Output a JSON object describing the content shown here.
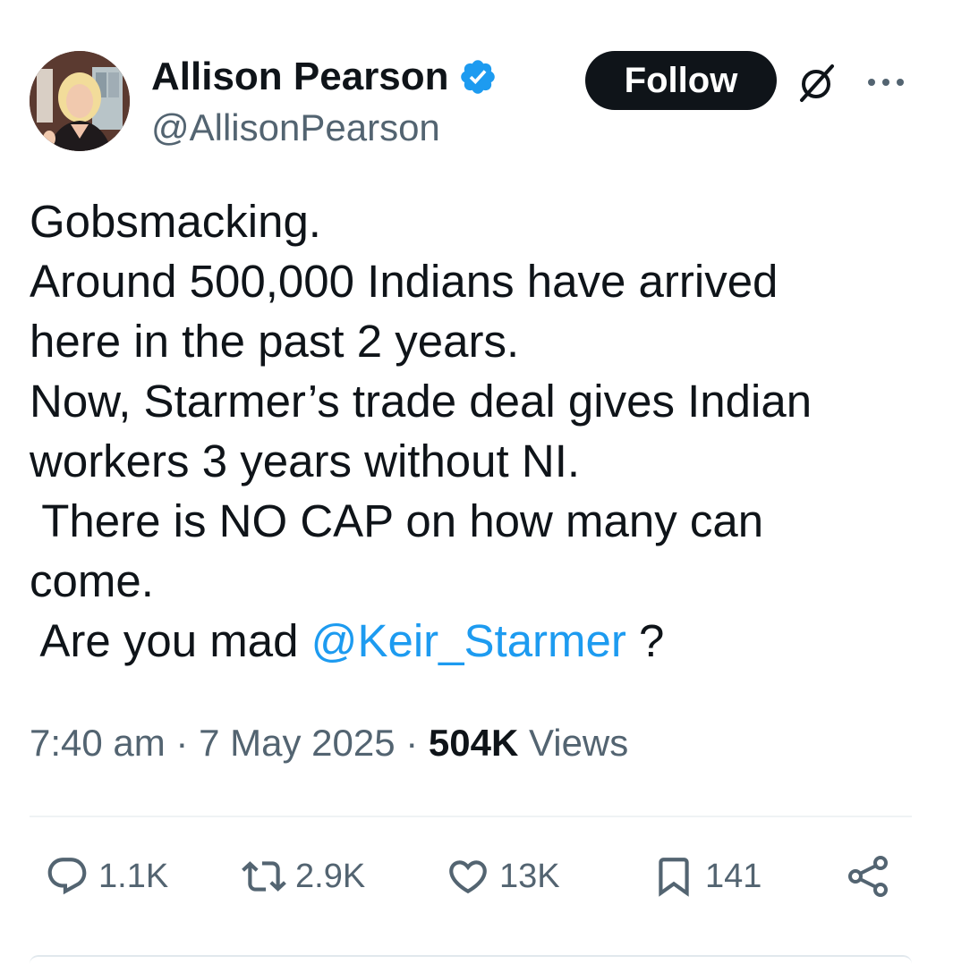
{
  "author": {
    "display_name": "Allison Pearson",
    "handle": "@AllisonPearson",
    "verified_icon": "verified-badge-icon",
    "verified_color": "#1d9bf0"
  },
  "header": {
    "follow_label": "Follow",
    "grok_icon": "grok-icon",
    "more_icon": "more-options-icon"
  },
  "tweet": {
    "lines": [
      "Gobsmacking.",
      "Around 500,000 Indians have arrived",
      "here in the past 2 years.",
      "Now, Starmer’s trade deal gives Indian",
      "workers 3 years without NI.",
      " There is NO CAP on how many can",
      "come."
    ],
    "last_line_prefix": " Are you mad ",
    "mention": "@Keir_Starmer",
    "last_line_suffix": " ?",
    "mention_color": "#1d9bf0"
  },
  "meta": {
    "time": "7:40 am",
    "separator": " · ",
    "date": "7 May 2025",
    "views_count": "504K",
    "views_label": "Views"
  },
  "actions": {
    "replies": "1.1K",
    "reposts": "2.9K",
    "likes": "13K",
    "bookmarks": "141"
  }
}
